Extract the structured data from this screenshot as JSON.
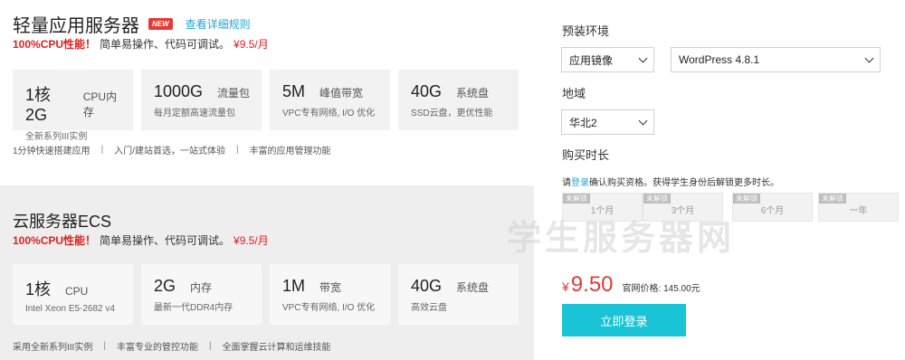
{
  "lightweight": {
    "title": "轻量应用服务器",
    "badge": "NEW",
    "detail_link": "查看详细规则",
    "promo": {
      "strong": "100%CPU性能！",
      "text": "简单易操作、代码可调试。",
      "price": "¥9.5/月"
    },
    "specs": [
      {
        "big": "1核2G",
        "unit": "CPU内存",
        "desc": "全新系列III实例"
      },
      {
        "big": "1000G",
        "unit": "流量包",
        "desc": "每月定额高速流量包"
      },
      {
        "big": "5M",
        "unit": "峰值带宽",
        "desc": "VPC专有网络, I/O 优化"
      },
      {
        "big": "40G",
        "unit": "系统盘",
        "desc": "SSD云盘，更优性能"
      }
    ],
    "features": [
      "1分钟快速搭建应用",
      "入门/建站首选，一站式体验",
      "丰富的应用管理功能"
    ],
    "separator": "|"
  },
  "ecs": {
    "title": "云服务器ECS",
    "promo": {
      "strong": "100%CPU性能！",
      "text": "简单易操作、代码可调试。",
      "price": "¥9.5/月"
    },
    "specs": [
      {
        "big": "1核",
        "unit": "CPU",
        "desc": "Intel Xeon E5-2682 v4"
      },
      {
        "big": "2G",
        "unit": "内存",
        "desc": "最新一代DDR4内存"
      },
      {
        "big": "1M",
        "unit": "带宽",
        "desc": "VPC专有网络, I/O 优化"
      },
      {
        "big": "40G",
        "unit": "系统盘",
        "desc": "高效云盘"
      }
    ],
    "features": [
      "采用全新系列III实例",
      "丰富专业的管控功能",
      "全面掌握云计算和运维技能"
    ],
    "separator": "|"
  },
  "order": {
    "preinstall_label": "预装环境",
    "image_type": "应用镜像",
    "image_version": "WordPress 4.8.1",
    "region_label": "地域",
    "region": "华北2",
    "duration_label": "购买时长",
    "notice_prefix": "请",
    "notice_link": "登录",
    "notice_suffix": "确认购买资格。获得学生身份后解锁更多时长。",
    "lock_label": "未解锁",
    "durations": [
      "1个月",
      "3个月",
      "6个月",
      "一年"
    ],
    "price_symbol": "¥",
    "price": "9.50",
    "official_price": "官网价格: 145.00元",
    "login_button": "立即登录"
  },
  "watermark": "学生服务器网"
}
